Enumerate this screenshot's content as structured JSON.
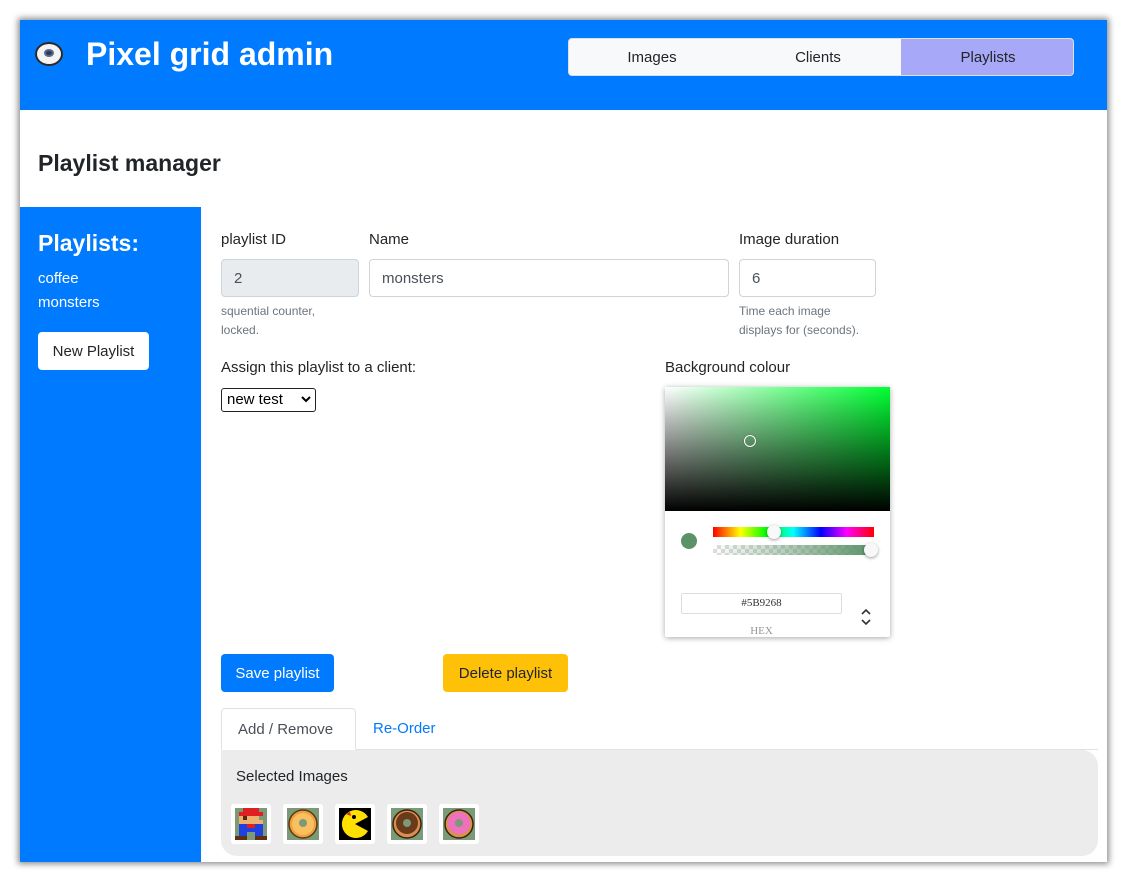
{
  "app": {
    "title": "Pixel grid admin",
    "logo_icon": "donut-icon"
  },
  "nav": {
    "tabs": [
      {
        "label": "Images"
      },
      {
        "label": "Clients"
      },
      {
        "label": "Playlists",
        "active": true
      }
    ]
  },
  "page": {
    "title": "Playlist manager"
  },
  "sidebar": {
    "title": "Playlists:",
    "items": [
      {
        "label": "coffee"
      },
      {
        "label": "monsters"
      }
    ],
    "new_button": "New Playlist"
  },
  "form": {
    "playlist_id": {
      "label": "playlist ID",
      "value": "2",
      "help_line1": "squential counter,",
      "help_line2": "locked."
    },
    "name": {
      "label": "Name",
      "value": "monsters"
    },
    "duration": {
      "label": "Image duration",
      "value": "6",
      "help_line1": "Time each image",
      "help_line2": "displays for (seconds)."
    },
    "assign": {
      "label": "Assign this playlist to a client:",
      "selected": "new test"
    },
    "background": {
      "label": "Background colour",
      "hex": "#5B9268",
      "format_label": "HEX",
      "color": "#5b9268"
    }
  },
  "actions": {
    "save": "Save playlist",
    "delete": "Delete playlist"
  },
  "tabs": [
    {
      "label": "Add / Remove",
      "active": true
    },
    {
      "label": "Re-Order"
    }
  ],
  "selected_images": {
    "title": "Selected Images",
    "images": [
      {
        "icon": "mario-icon"
      },
      {
        "icon": "orange-donut-icon"
      },
      {
        "icon": "pacman-icon"
      },
      {
        "icon": "chocolate-donut-icon"
      },
      {
        "icon": "pink-donut-icon"
      }
    ]
  },
  "colors": {
    "primary": "#007bff",
    "warning": "#ffc107",
    "nav_active": "#a8a8f8"
  }
}
